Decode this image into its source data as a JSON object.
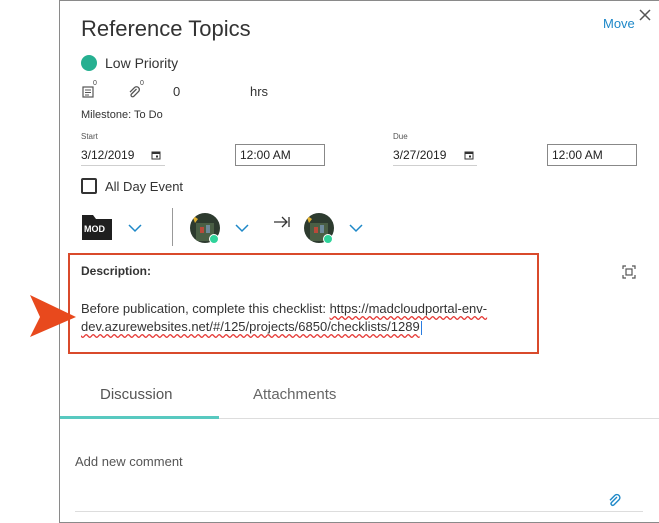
{
  "header": {
    "title": "Reference Topics",
    "move_label": "Move"
  },
  "priority": {
    "label": "Low Priority",
    "color": "#26b091"
  },
  "counts": {
    "notes_count": "0",
    "attachments_count": "0",
    "hours_value": "0",
    "hours_label": "hrs"
  },
  "milestone": "Milestone: To Do",
  "dates": {
    "start_label": "Start",
    "start_date": "3/12/2019",
    "start_time": "12:00 AM",
    "due_label": "Due",
    "due_date": "3/27/2019",
    "due_time": "12:00 AM"
  },
  "all_day": {
    "label": "All Day Event",
    "checked": false
  },
  "assignment": {
    "module_badge": "MOD"
  },
  "description": {
    "title": "Description:",
    "text_prefix": "Before publication, complete this checklist: ",
    "link": "https://madcloudportal-env-dev.azurewebsites.net/#/125/projects/6850/checklists/1289"
  },
  "tabs": [
    {
      "label": "Discussion",
      "active": true
    },
    {
      "label": "Attachments",
      "active": false
    }
  ],
  "comment": {
    "placeholder": "Add new comment"
  },
  "colors": {
    "accent_link": "#1e88c8",
    "highlight_border": "#d94a2b",
    "tab_active": "#58c9c0",
    "online": "#2fd39a"
  }
}
